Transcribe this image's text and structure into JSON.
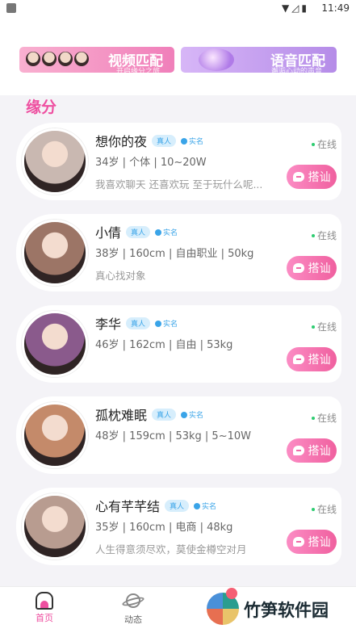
{
  "status_bar": {
    "time": "11:49"
  },
  "banners": [
    {
      "title": "视频匹配",
      "subtitle": "开启缘分之旅"
    },
    {
      "title": "语音匹配",
      "subtitle": "邂逅心动的声音"
    }
  ],
  "section_title": "缘分",
  "badge_real": "真人",
  "badge_verified": "实名",
  "online_label": "在线",
  "chat_label": "搭讪",
  "users": [
    {
      "name": "想你的夜",
      "info": "34岁 | 个体 | 10~20W",
      "bio": "我喜欢聊天 还喜欢玩 至于玩什么呢...",
      "avatar_color": "#c9b8b1"
    },
    {
      "name": "小倩",
      "info": "38岁 | 160cm | 自由职业 | 50kg",
      "bio": "真心找对象",
      "avatar_color": "#9c7566"
    },
    {
      "name": "李华",
      "info": "46岁 | 162cm | 自由 | 53kg",
      "bio": "",
      "avatar_color": "#8a5a8c"
    },
    {
      "name": "孤枕难眠",
      "info": "48岁 | 159cm | 53kg | 5~10W",
      "bio": "",
      "avatar_color": "#c48a6a"
    },
    {
      "name": "心有芊芊结",
      "info": "35岁 | 160cm | 电商 | 48kg",
      "bio": "人生得意须尽欢，莫使金樽空对月",
      "avatar_color": "#b89c90"
    }
  ],
  "tabs": [
    {
      "label": "首页"
    },
    {
      "label": "动态"
    }
  ],
  "watermark": "竹笋软件园"
}
